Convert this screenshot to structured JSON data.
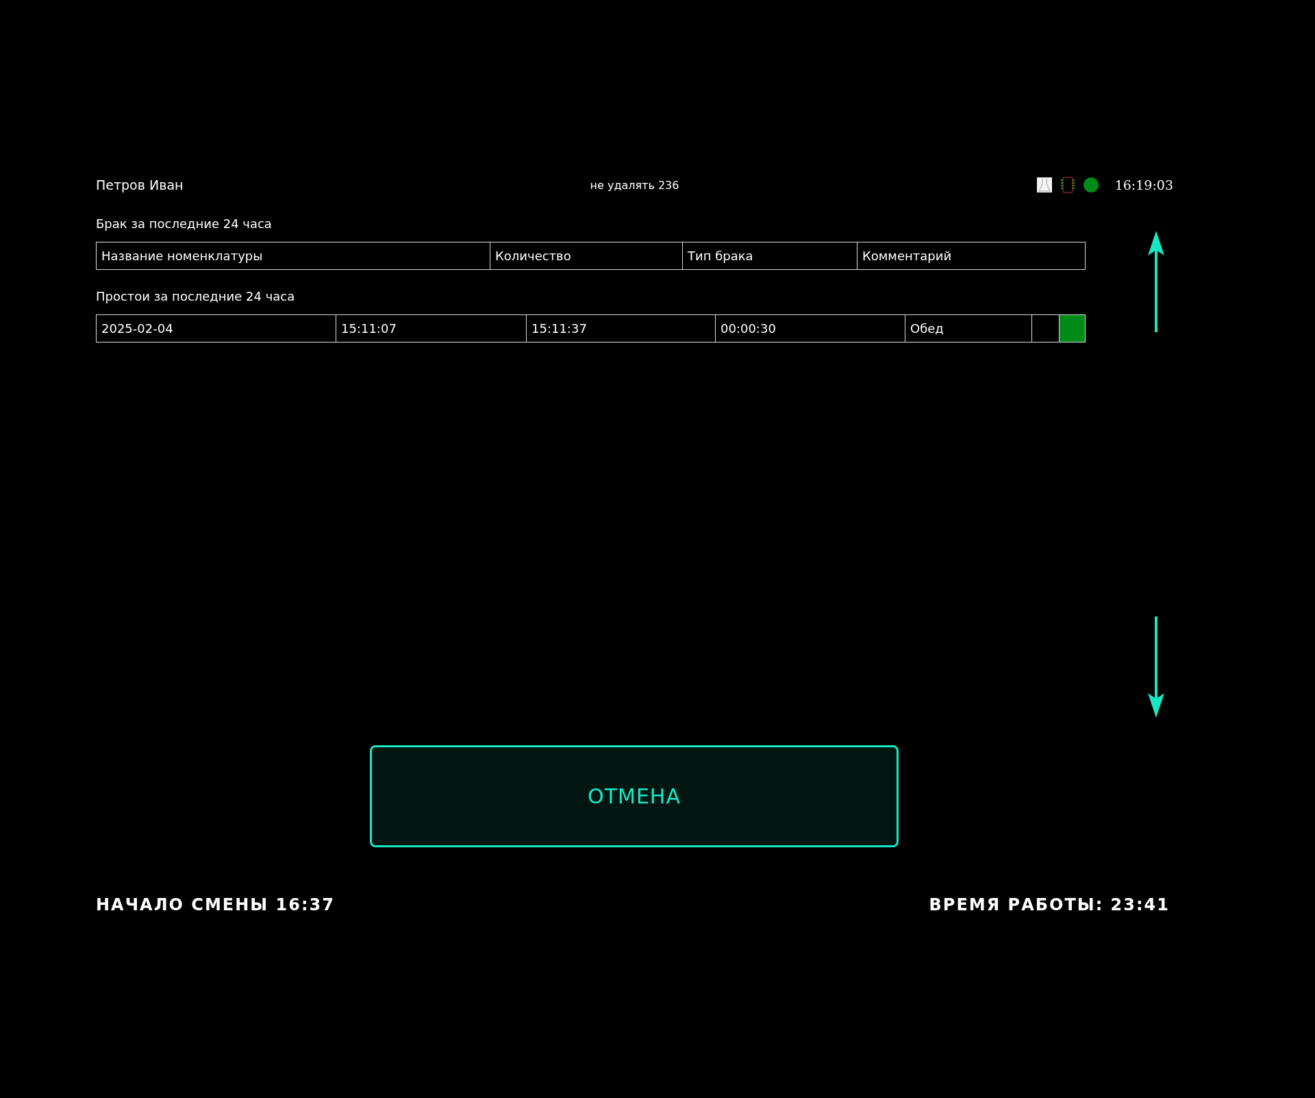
{
  "header": {
    "operator": "Петров Иван",
    "center_note": "не удалять 236",
    "status_dot": {
      "color": "#008a1a"
    },
    "clock": "16:19:03"
  },
  "defects": {
    "title": "Брак за последние 24 часа",
    "columns": [
      "Название номенклатуры",
      "Количество",
      "Тип брака",
      "Комментарий"
    ]
  },
  "downtime": {
    "title": "Простои за последние 24 часа",
    "rows": [
      {
        "cells": [
          "2025-02-04",
          "15:11:07",
          "15:11:37",
          "00:00:30",
          "Обед",
          ""
        ],
        "color": "#008a1a"
      }
    ]
  },
  "cancel_button": "ОТМЕНА",
  "footer": {
    "shift_start": "НАЧАЛО СМЕНЫ 16:37",
    "work_time": "ВРЕМЯ РАБОТЫ: 23:41"
  }
}
